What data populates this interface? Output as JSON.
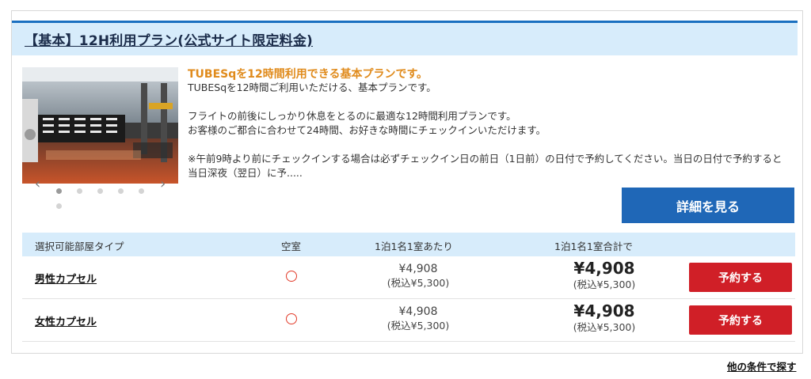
{
  "plan": {
    "title": "【基本】12H利用プラン(公式サイト限定料金)",
    "headline": "TUBESqを12時間利用できる基本プランです。",
    "description": [
      "TUBESqを12時間ご利用いただける、基本プランです。",
      "",
      "フライトの前後にしっかり休息をとるのに最適な12時間利用プランです。",
      "お客様のご都合に合わせて24時間、お好きな時間にチェックインいただけます。",
      "",
      "※午前9時より前にチェックインする場合は必ずチェックイン日の前日（1日前）の日付で予約してください。当日の日付で予約すると当日深夜（翌日）に予....."
    ],
    "detail_button": "詳細を見る"
  },
  "carousel": {
    "prev": "‹",
    "next": "›",
    "slide_count": 6,
    "active_index": 0
  },
  "table": {
    "headers": {
      "room_type": "選択可能部屋タイプ",
      "vacancy": "空室",
      "per_person": "1泊1名1室あたり",
      "total": "1泊1名1室合計で"
    },
    "rows": [
      {
        "room": "男性カプセル",
        "vacancy": "○",
        "price": "¥4,908",
        "price_tax": "(税込¥5,300)",
        "total": "¥4,908",
        "total_tax": "(税込¥5,300)",
        "button": "予約する"
      },
      {
        "room": "女性カプセル",
        "vacancy": "○",
        "price": "¥4,908",
        "price_tax": "(税込¥5,300)",
        "total": "¥4,908",
        "total_tax": "(税込¥5,300)",
        "button": "予約する"
      }
    ]
  },
  "other_link": "他の条件で探す",
  "colors": {
    "header_bg": "#d7ecfb",
    "header_border": "#1a6fc0",
    "headline": "#e08b1c",
    "detail_button": "#1f67b7",
    "reserve_button": "#d01f27",
    "vacancy_mark": "#e23b2a"
  }
}
